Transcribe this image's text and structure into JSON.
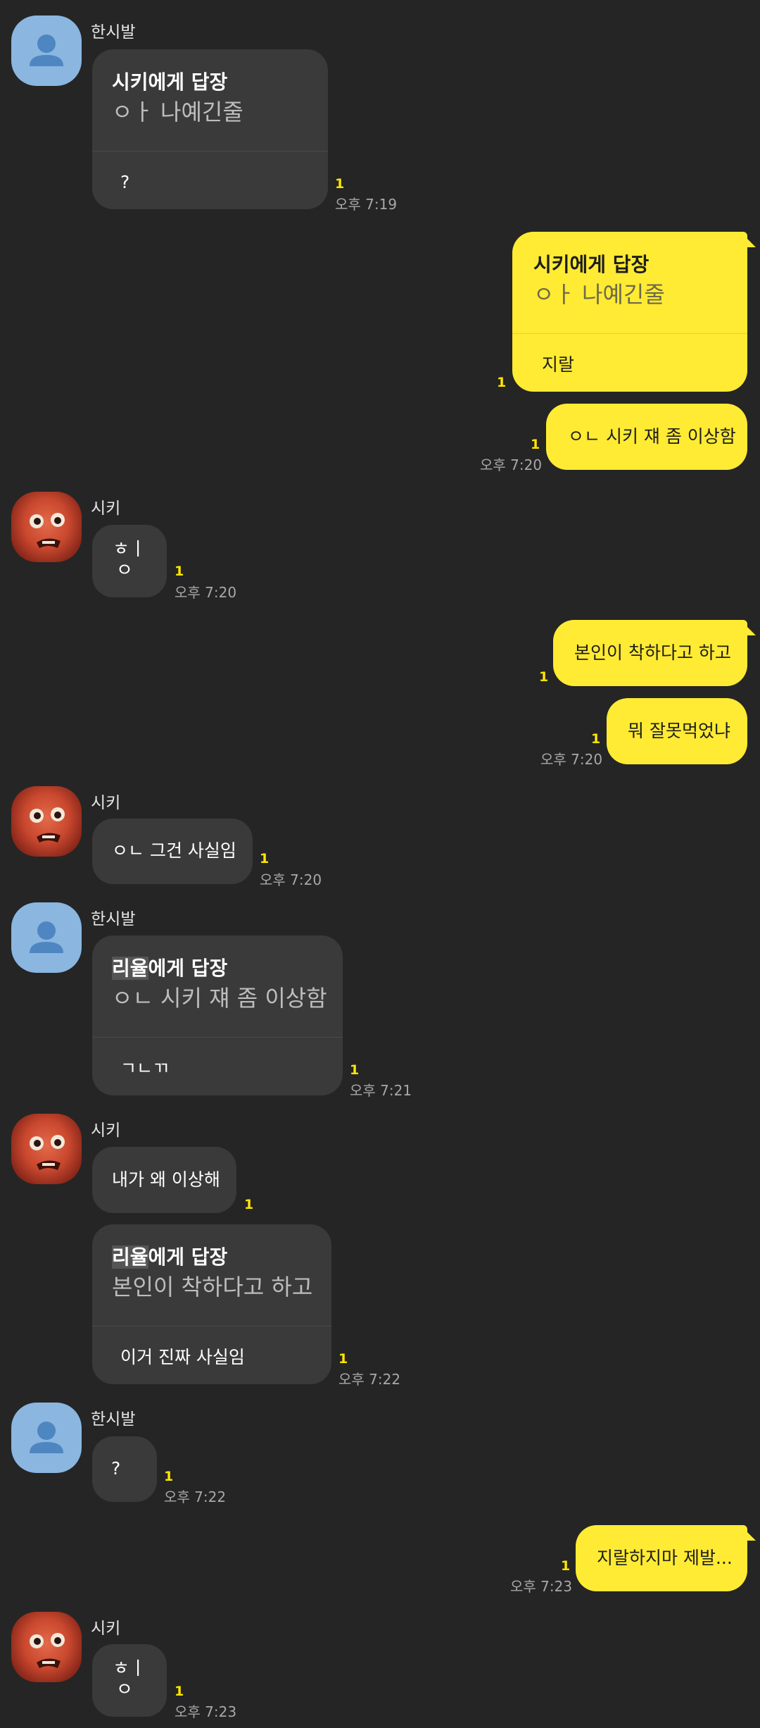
{
  "senders": {
    "hansibal": "한시발",
    "siki": "시키"
  },
  "messages": {
    "m1": {
      "reply_to": "시키에게 답장",
      "quote": "ㅇㅏ 나예긴줄",
      "text": "?",
      "unread": "1",
      "time": "오후 7:19"
    },
    "m2": {
      "reply_to": "시키에게 답장",
      "quote": "ㅇㅏ 나예긴줄",
      "text": "지랄",
      "unread": "1"
    },
    "m3": {
      "text": "ㅇㄴ 시키 쟤 좀 이상함",
      "unread": "1",
      "time": "오후 7:20"
    },
    "m4": {
      "text_top": "ㅎㅣ",
      "text_bottom": "ㅇ",
      "unread": "1",
      "time": "오후 7:20"
    },
    "m5": {
      "text": "본인이 착하다고 하고",
      "unread": "1"
    },
    "m6": {
      "text": "뭐 잘못먹었냐",
      "unread": "1",
      "time": "오후 7:20"
    },
    "m7": {
      "text": "ㅇㄴ 그건 사실임",
      "unread": "1",
      "time": "오후 7:20"
    },
    "m8": {
      "reply_to_name": "리율",
      "reply_to_suffix": "에게 답장",
      "quote": "ㅇㄴ 시키 쟤 좀 이상함",
      "text": "ㄱㄴㄲ",
      "unread": "1",
      "time": "오후 7:21"
    },
    "m9": {
      "text": "내가 왜 이상해",
      "unread": "1"
    },
    "m10": {
      "reply_to_name": "리율",
      "reply_to_suffix": "에게 답장",
      "quote": "본인이 착하다고 하고",
      "text": "이거 진짜 사실임",
      "unread": "1",
      "time": "오후 7:22"
    },
    "m11": {
      "text": "?",
      "unread": "1",
      "time": "오후 7:22"
    },
    "m12": {
      "text": "지랄하지마 제발...",
      "unread": "1",
      "time": "오후 7:23"
    },
    "m13": {
      "text_top": "ㅎㅣ",
      "text_bottom": "ㅇ",
      "unread": "1",
      "time": "오후 7:23"
    }
  },
  "colors": {
    "background": "#252525",
    "incoming_bubble": "#3a3a3a",
    "outgoing_bubble": "#ffeb33",
    "unread_count": "#ffe600",
    "default_avatar": "#8ab6e0"
  },
  "icons": {
    "default_avatar": "person-silhouette-icon",
    "photo_avatar": "profile-photo"
  }
}
